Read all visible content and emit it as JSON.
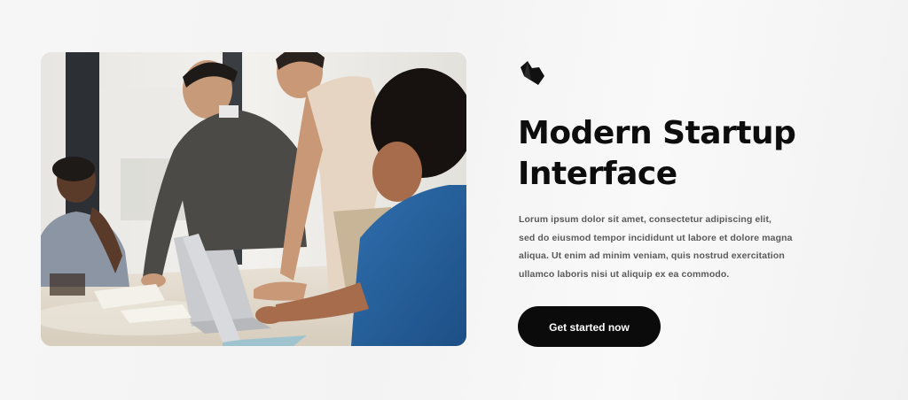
{
  "hero": {
    "headline_line1": "Modern Startup",
    "headline_line2": "Interface",
    "body_lines": [
      "Lorum ipsum dolor sit amet, consectetur adipiscing elit,",
      "sed do eiusmod tempor incididunt ut labore et dolore magna",
      "aliqua. Ut enim ad minim veniam, quis nostrud exercitation",
      "ullamco laboris nisi ut aliquip ex ea commodo."
    ],
    "cta_label": "Get started now",
    "brand_icon": "crown-logo-icon",
    "accent_color": "#0b0b0b",
    "image_subject": "team-meeting-photo"
  }
}
